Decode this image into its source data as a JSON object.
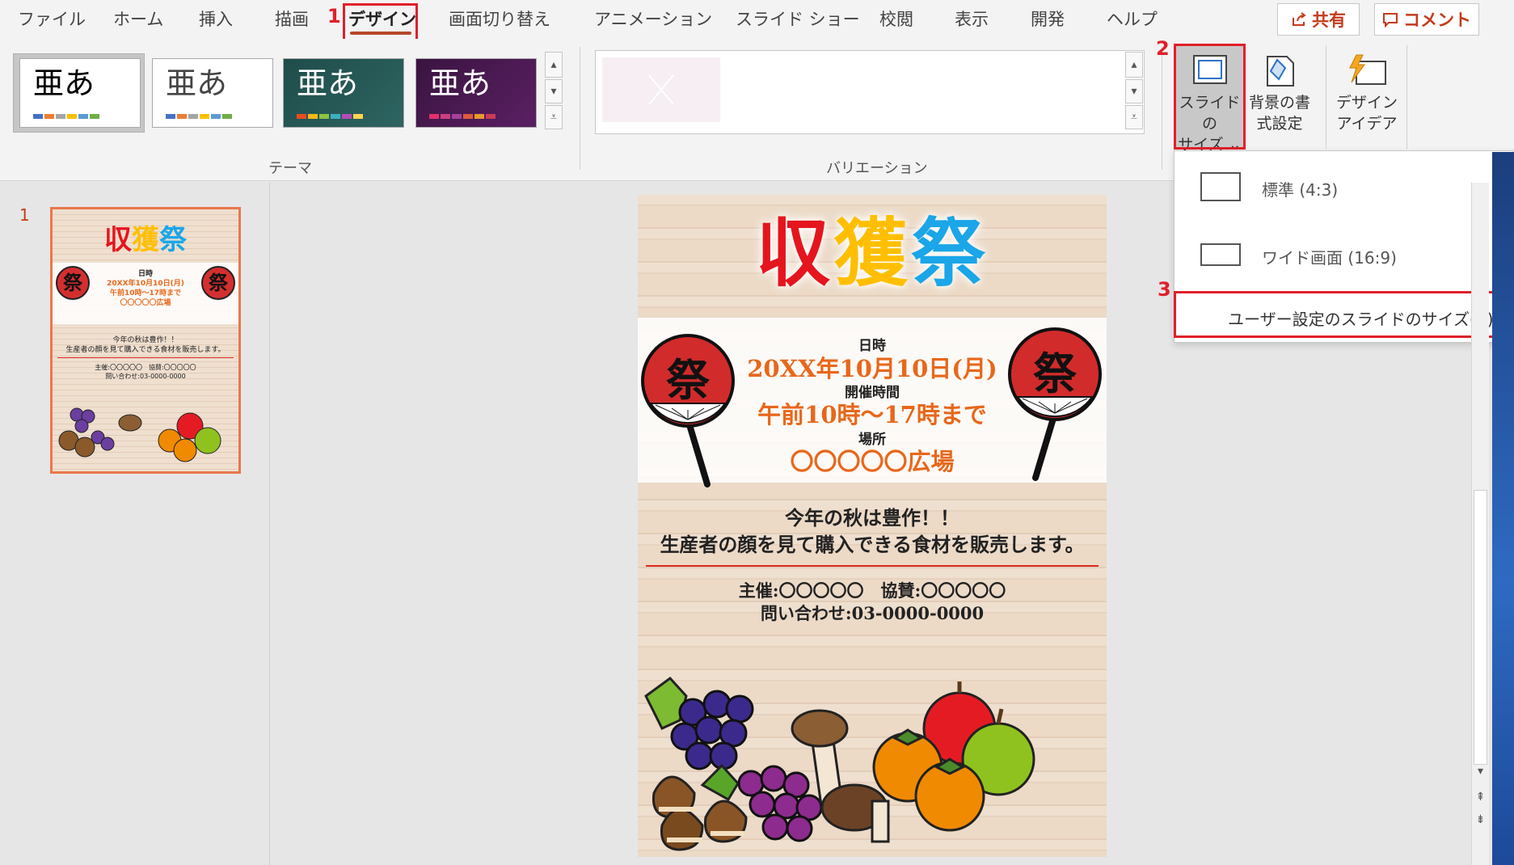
{
  "tabs": [
    "ファイル",
    "ホーム",
    "挿入",
    "描画",
    "デザイン",
    "画面切り替え",
    "アニメーション",
    "スライド ショー",
    "校閲",
    "表示",
    "開発",
    "ヘルプ"
  ],
  "active_tab": "デザイン",
  "steps": {
    "s1": "1",
    "s2": "2",
    "s3": "3"
  },
  "share_label": "共有",
  "comment_label": "コメント",
  "ribbon": {
    "theme_sample": "亜あ",
    "theme_group_label": "テーマ",
    "variation_group_label": "バリエーション",
    "slide_size_btn": [
      "スライドの",
      "サイズ ⌄"
    ],
    "bg_format_btn": [
      "背景の書",
      "式設定"
    ],
    "design_ideas_btn": [
      "デザイン",
      "アイデア"
    ]
  },
  "dropdown": {
    "standard": "標準 (4:3)",
    "wide": "ワイド画面 (16:9)",
    "custom": "ユーザー設定のスライドのサイズ(C)..."
  },
  "thumbnail": {
    "number": "1"
  },
  "slide": {
    "title_chars": [
      "収",
      "獲",
      "祭"
    ],
    "fan_char": "祭",
    "date_label": "日時",
    "date_value": "20XX年10月10日(月)",
    "time_label": "開催時間",
    "time_value": "午前10時～17時まで",
    "place_label": "場所",
    "place_value": "〇〇〇〇〇広場",
    "line1": "今年の秋は豊作！！",
    "line2": "生産者の顔を見て購入できる食材を販売します。",
    "sponsor": "主催:〇〇〇〇〇　協賛:〇〇〇〇〇",
    "contact": "問い合わせ:03-0000-0000"
  },
  "colors": {
    "accent": "#b7472a",
    "highlight": "#e0202a",
    "title_red": "#e5151e",
    "title_yellow": "#ffbf00",
    "title_blue": "#1aa6e8",
    "slide_orange": "#e8671a"
  }
}
